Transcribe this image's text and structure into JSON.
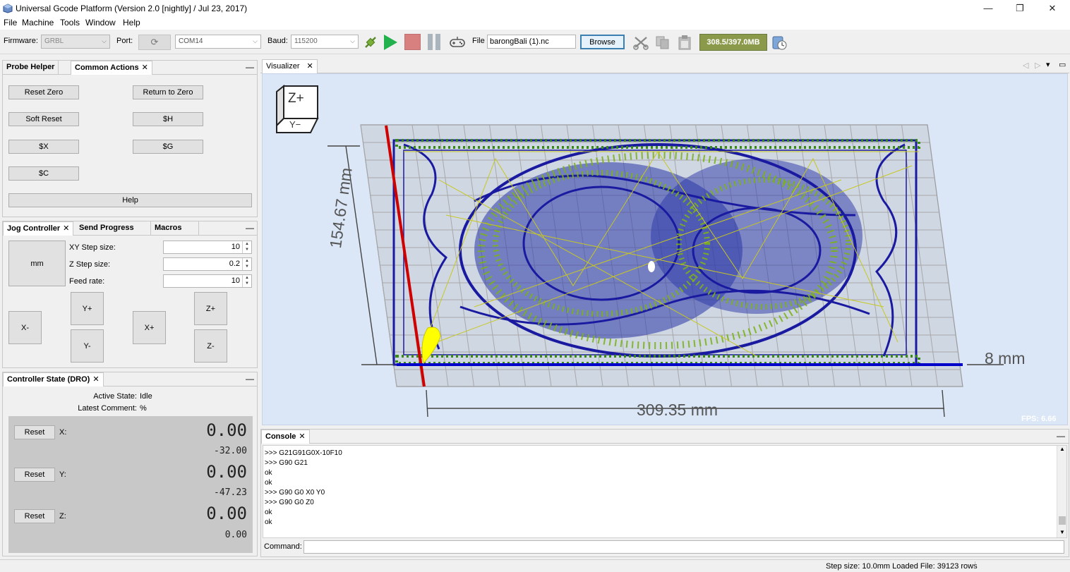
{
  "window": {
    "title": "Universal Gcode Platform (Version 2.0 [nightly]  / Jul 23, 2017)",
    "minimize": "—",
    "restore": "❐",
    "close": "✕"
  },
  "menu": [
    "File",
    "Machine",
    "Tools",
    "Window",
    "Help"
  ],
  "toolbar": {
    "firmware_label": "Firmware:",
    "firmware_value": "GRBL",
    "port_label": "Port:",
    "port_value": "COM14",
    "baud_label": "Baud:",
    "baud_value": "115200",
    "file_label": "File",
    "file_value": "barongBali (1).nc",
    "browse_label": "Browse",
    "memory": "308.5/397.0MB",
    "colors": {
      "play": "#23b14d",
      "stop": "#d88080",
      "pause": "#a9b4bd",
      "memory_bg": "#8a9a4a"
    }
  },
  "common_actions": {
    "tabs": [
      "Probe Helper",
      "Common Actions"
    ],
    "buttons": [
      "Reset Zero",
      "Return to Zero",
      "Soft Reset",
      "$H",
      "$X",
      "$G",
      "$C"
    ],
    "help": "Help"
  },
  "jog": {
    "tabs": [
      "Jog Controller",
      "Send Progress",
      "Macros"
    ],
    "unit_button": "mm",
    "xy_step_label": "XY Step size:",
    "xy_step_value": "10",
    "z_step_label": "Z Step size:",
    "z_step_value": "0.2",
    "feed_label": "Feed rate:",
    "feed_value": "10",
    "buttons": {
      "xminus": "X-",
      "xplus": "X+",
      "yplus": "Y+",
      "yminus": "Y-",
      "zplus": "Z+",
      "zminus": "Z-"
    }
  },
  "dro": {
    "tab": "Controller State (DRO)",
    "active_state_label": "Active State:",
    "active_state_value": "Idle",
    "latest_comment_label": "Latest Comment:",
    "latest_comment_value": "%",
    "reset_label": "Reset",
    "axes": [
      {
        "name": "X:",
        "work": "0.00",
        "machine": "-32.00"
      },
      {
        "name": "Y:",
        "work": "0.00",
        "machine": "-47.23"
      },
      {
        "name": "Z:",
        "work": "0.00",
        "machine": "0.00"
      }
    ]
  },
  "visualizer": {
    "tab": "Visualizer",
    "cube_top": "Z+",
    "cube_front": "Y−",
    "dim_height": "154.67 mm",
    "dim_width": "309.35 mm",
    "dim_depth": "8 mm",
    "fps": "FPS: 6.66",
    "colors": {
      "background": "#dbe7f7",
      "grid": "#b0b0b0",
      "toolpath": "#1a1aa0",
      "rapid": "#c8c820",
      "x_axis": "#d00000",
      "y_axis": "#0000c8",
      "tool": "#ffff00"
    }
  },
  "console": {
    "tab": "Console",
    "lines": ">>> G21G91G0X-10F10\n>>> G90 G21\nok\nok\n>>> G90 G0 X0 Y0\n>>> G90 G0 Z0\nok\nok",
    "command_label": "Command:",
    "command_value": ""
  },
  "status": {
    "text": "Step size: 10.0mm Loaded File: 39123 rows"
  }
}
